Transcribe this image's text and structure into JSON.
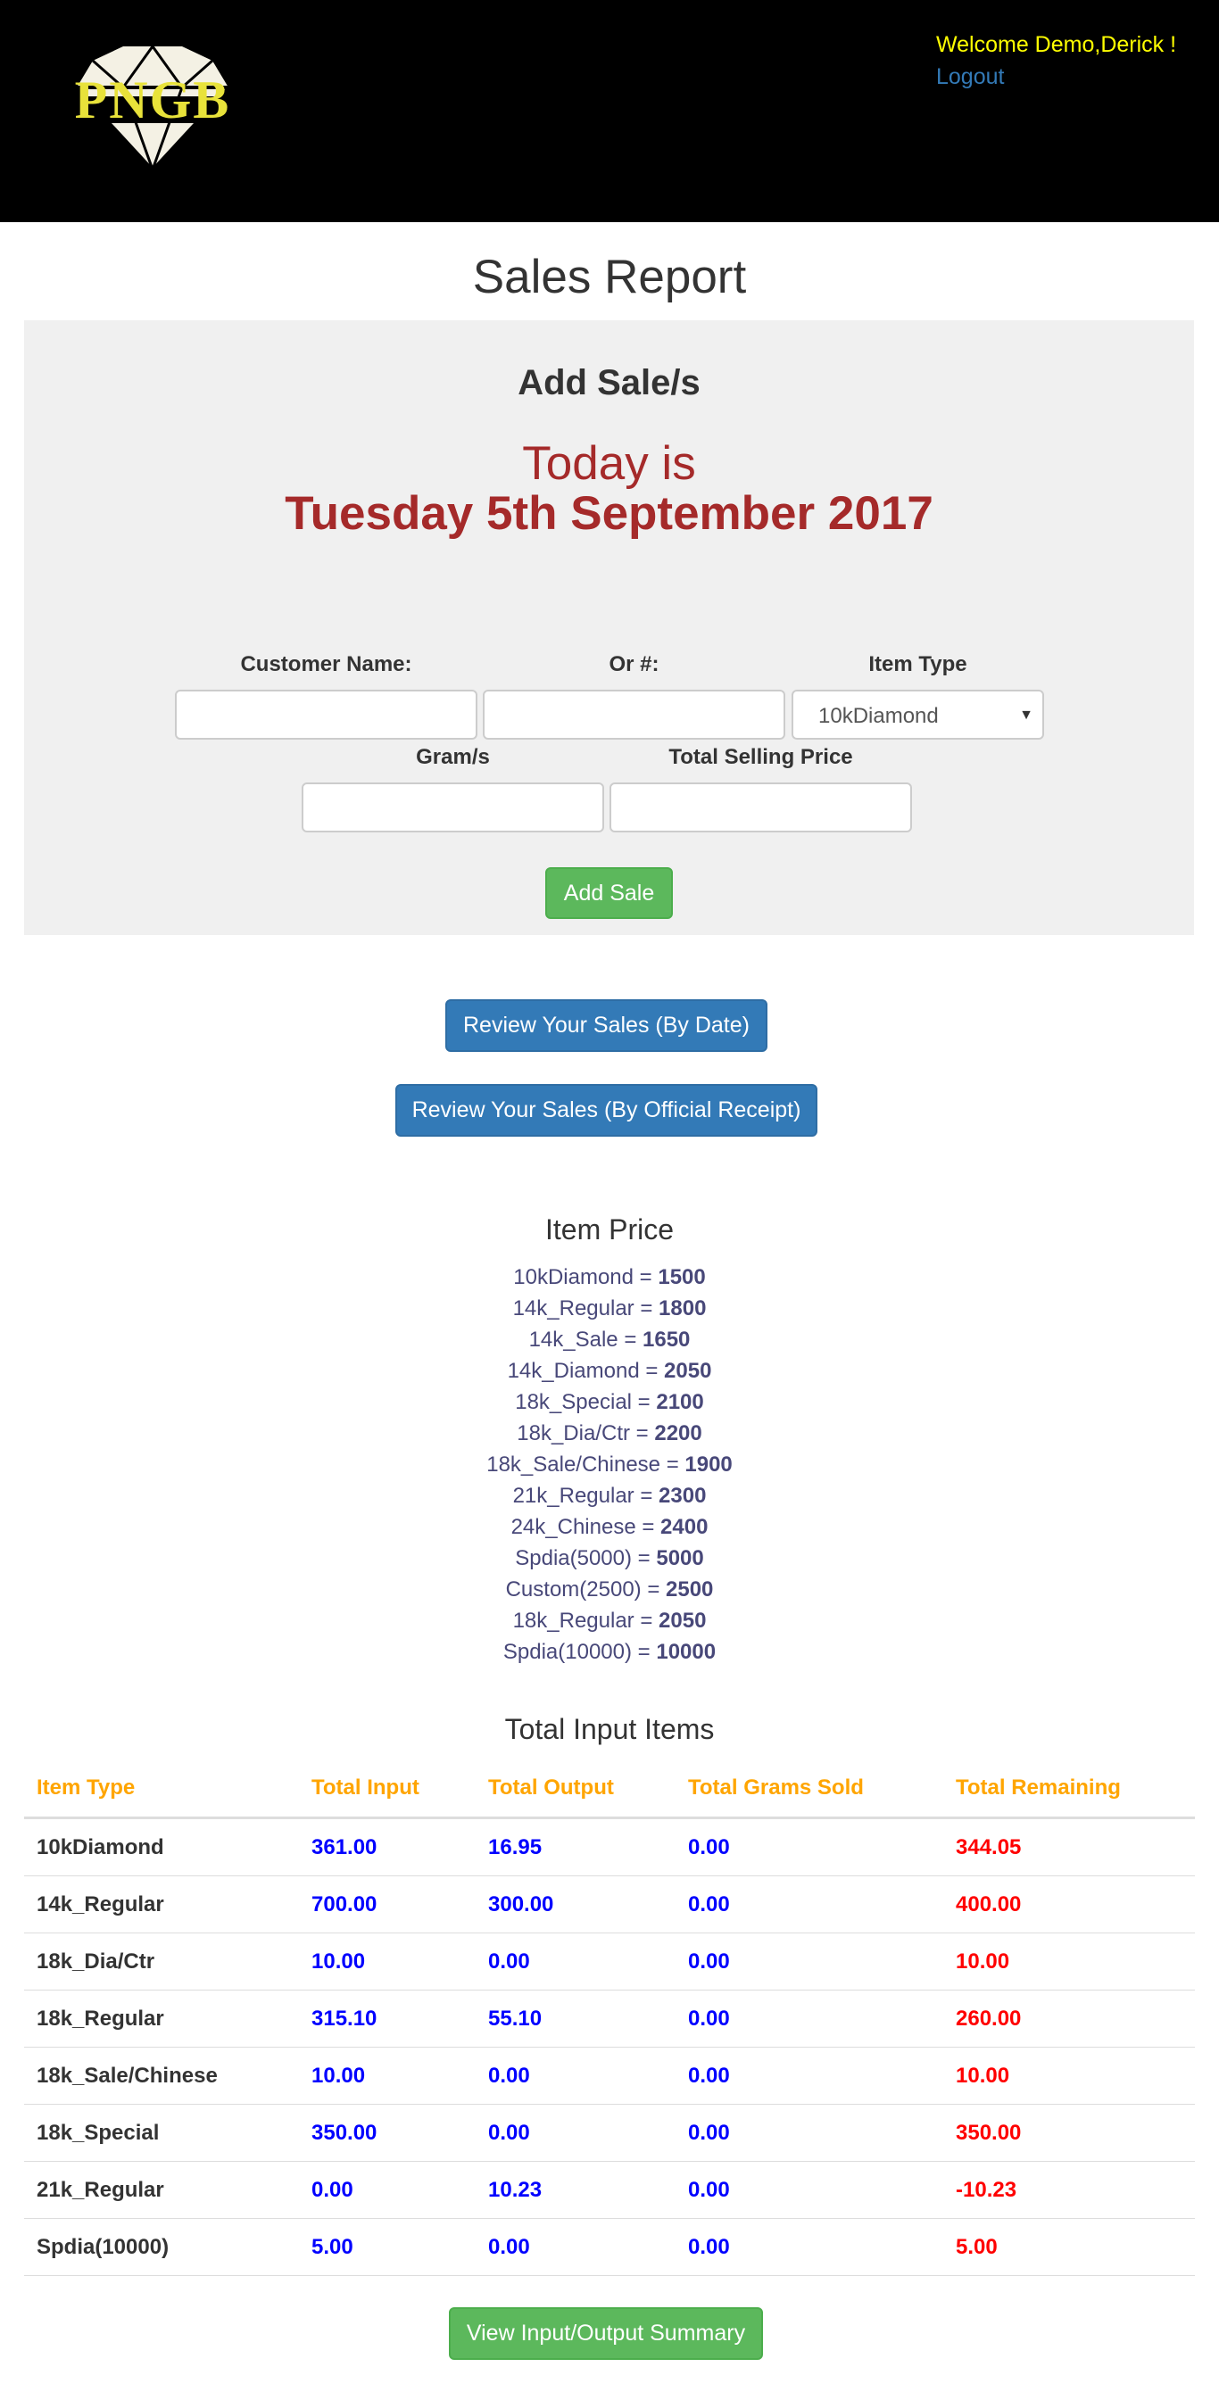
{
  "header": {
    "logo_text": "PNGB",
    "welcome": "Welcome Demo,Derick !",
    "logout": "Logout"
  },
  "page_title": "Sales Report",
  "add_sale": {
    "title": "Add Sale/s",
    "today_label": "Today is",
    "date": "Tuesday 5th September 2017",
    "fields": {
      "customer_name_label": "Customer Name:",
      "or_label": "Or #:",
      "item_type_label": "Item Type",
      "item_type_value": "10kDiamond",
      "grams_label": "Gram/s",
      "total_price_label": "Total Selling Price"
    },
    "submit_label": "Add Sale"
  },
  "review_by_date_label": "Review Your Sales (By Date)",
  "review_by_receipt_label": "Review Your Sales (By Official Receipt)",
  "item_price": {
    "title": "Item Price",
    "items": [
      {
        "name": "10kDiamond",
        "price": "1500"
      },
      {
        "name": "14k_Regular",
        "price": "1800"
      },
      {
        "name": "14k_Sale",
        "price": "1650"
      },
      {
        "name": "14k_Diamond",
        "price": "2050"
      },
      {
        "name": "18k_Special",
        "price": "2100"
      },
      {
        "name": "18k_Dia/Ctr",
        "price": "2200"
      },
      {
        "name": "18k_Sale/Chinese",
        "price": "1900"
      },
      {
        "name": "21k_Regular",
        "price": "2300"
      },
      {
        "name": "24k_Chinese",
        "price": "2400"
      },
      {
        "name": "Spdia(5000)",
        "price": "5000"
      },
      {
        "name": "Custom(2500)",
        "price": "2500"
      },
      {
        "name": "18k_Regular",
        "price": "2050"
      },
      {
        "name": "Spdia(10000)",
        "price": "10000"
      }
    ]
  },
  "total_input": {
    "title": "Total Input Items",
    "headers": [
      "Item Type",
      "Total Input",
      "Total Output",
      "Total Grams Sold",
      "Total Remaining"
    ],
    "rows": [
      [
        "10kDiamond",
        "361.00",
        "16.95",
        "0.00",
        "344.05"
      ],
      [
        "14k_Regular",
        "700.00",
        "300.00",
        "0.00",
        "400.00"
      ],
      [
        "18k_Dia/Ctr",
        "10.00",
        "0.00",
        "0.00",
        "10.00"
      ],
      [
        "18k_Regular",
        "315.10",
        "55.10",
        "0.00",
        "260.00"
      ],
      [
        "18k_Sale/Chinese",
        "10.00",
        "0.00",
        "0.00",
        "10.00"
      ],
      [
        "18k_Special",
        "350.00",
        "0.00",
        "0.00",
        "350.00"
      ],
      [
        "21k_Regular",
        "0.00",
        "10.23",
        "0.00",
        "-10.23"
      ],
      [
        "Spdia(10000)",
        "5.00",
        "0.00",
        "0.00",
        "5.00"
      ]
    ]
  },
  "summary_button_label": "View Input/Output Summary",
  "colors": {
    "header_bg": "#000000",
    "welcome": "#ffff00",
    "date_red": "#a52a2a",
    "table_header": "#ffa500",
    "value_blue": "#0000ff",
    "remaining_red": "#ff0000",
    "button_green": "#5cb85c",
    "button_blue": "#337ab7"
  }
}
